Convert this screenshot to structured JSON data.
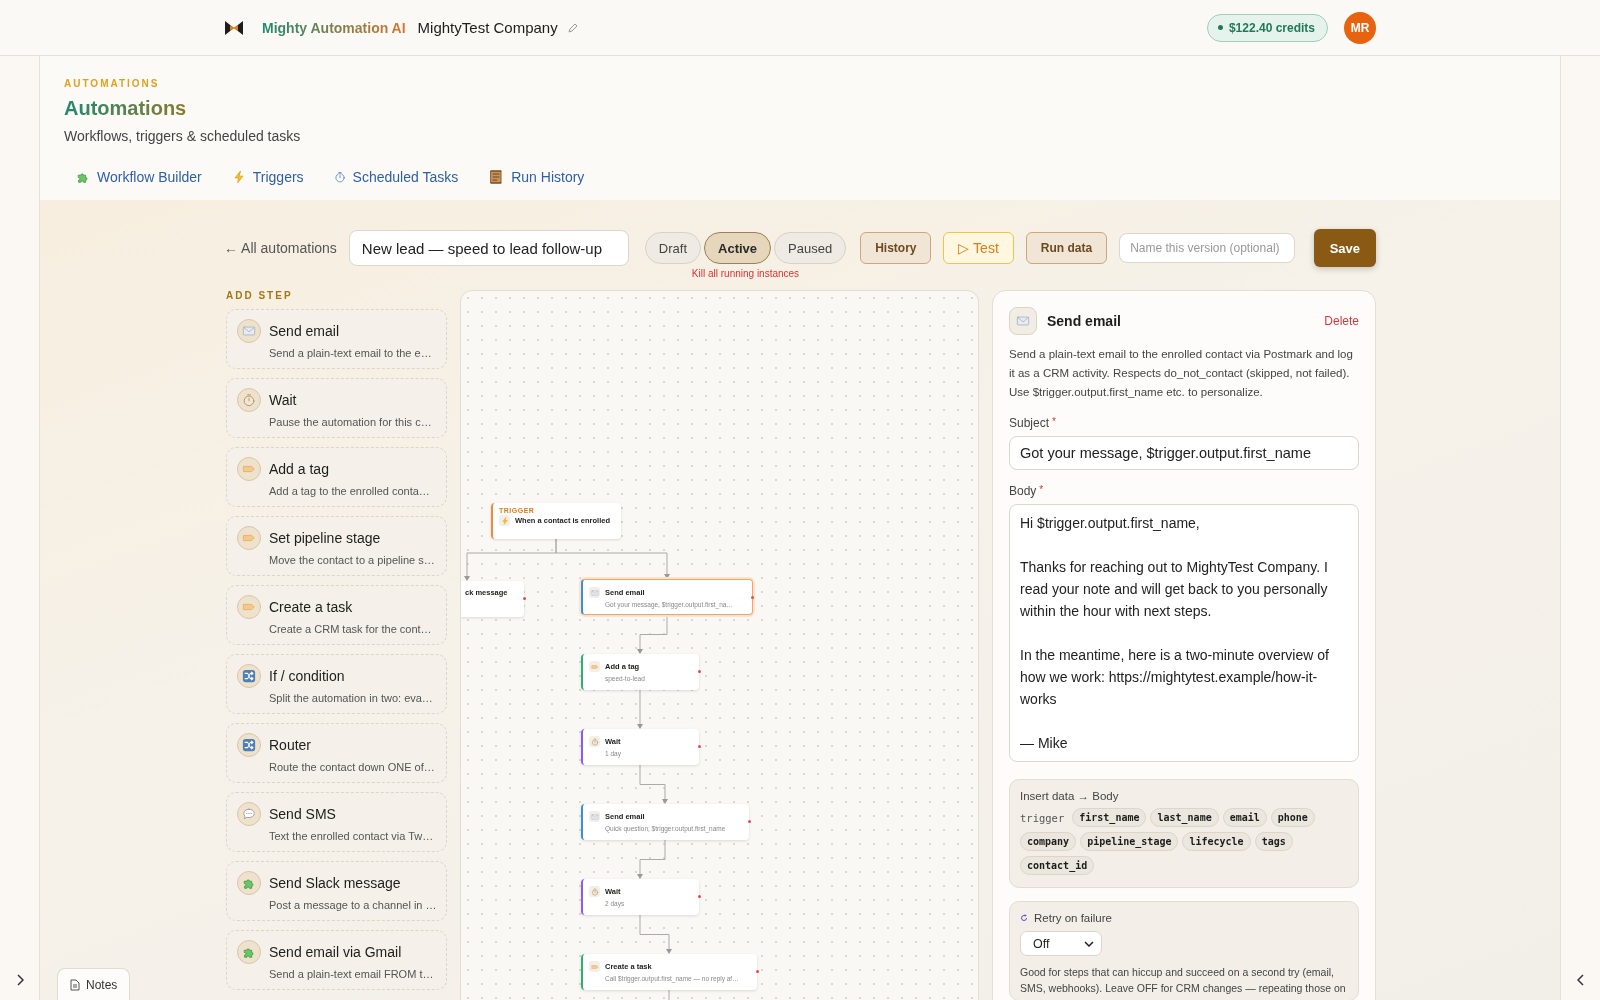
{
  "header": {
    "brand": "Mighty Automation AI",
    "workspace": "MightyTest Company",
    "credits": "$122.40 credits",
    "avatar": "MR"
  },
  "page": {
    "eyebrow": "AUTOMATIONS",
    "title": "Automations",
    "subtitle": "Workflows, triggers & scheduled tasks"
  },
  "tabs": [
    {
      "label": "Workflow Builder",
      "kind": "builder"
    },
    {
      "label": "Triggers",
      "kind": "triggers"
    },
    {
      "label": "Scheduled Tasks",
      "kind": "scheduled"
    },
    {
      "label": "Run History",
      "kind": "history"
    }
  ],
  "toolbar": {
    "back": "← All automations",
    "name": "New lead — speed to lead follow-up",
    "statuses": [
      {
        "label": "Draft",
        "selected": false
      },
      {
        "label": "Active",
        "selected": true
      },
      {
        "label": "Paused",
        "selected": false
      }
    ],
    "status_note": "Kill all running instances",
    "buttons": [
      {
        "label": "History",
        "kind": "plain"
      },
      {
        "label": "▷ Test",
        "kind": "test"
      },
      {
        "label": "Run data",
        "kind": "plain"
      }
    ],
    "version_placeholder": "Name this version (optional)",
    "save": "Save"
  },
  "add_step": {
    "heading": "ADD STEP",
    "items": [
      {
        "title": "Send email",
        "description": "Send a plain-text email to the e…",
        "kind": "email"
      },
      {
        "title": "Wait",
        "description": "Pause the automation for this c…",
        "kind": "wait"
      },
      {
        "title": "Add a tag",
        "description": "Add a tag to the enrolled conta…",
        "kind": "tag"
      },
      {
        "title": "Set pipeline stage",
        "description": "Move the contact to a pipeline s…",
        "kind": "pipeline"
      },
      {
        "title": "Create a task",
        "description": "Create a CRM task for the cont…",
        "kind": "task"
      },
      {
        "title": "If / condition",
        "description": "Split the automation in two: eva…",
        "kind": "condition"
      },
      {
        "title": "Router",
        "description": "Route the contact down ONE of…",
        "kind": "router"
      },
      {
        "title": "Send SMS",
        "description": "Text the enrolled contact via Tw…",
        "kind": "sms"
      },
      {
        "title": "Send Slack message",
        "description": "Post a message to a channel in …",
        "kind": "slack"
      },
      {
        "title": "Send email via Gmail",
        "description": "Send a plain-text email FROM t…",
        "kind": "gmail"
      }
    ]
  },
  "canvas": {
    "nodes": [
      {
        "kind": "trigger",
        "eyebrow": "TRIGGER",
        "title": "When a contact is enrolled",
        "selected": false
      },
      {
        "kind": "other",
        "title": "ck message",
        "selected": false
      },
      {
        "kind": "email",
        "title": "Send email",
        "subtitle": "Got your message, $trigger.output.first_na…",
        "selected": true
      },
      {
        "kind": "tag",
        "title": "Add a tag",
        "subtitle": "speed-to-lead",
        "selected": false
      },
      {
        "kind": "wait",
        "title": "Wait",
        "subtitle": "1 day",
        "selected": false
      },
      {
        "kind": "email",
        "title": "Send email",
        "subtitle": "Quick question, $trigger.output.first_name",
        "selected": false
      },
      {
        "kind": "wait",
        "title": "Wait",
        "subtitle": "2 days",
        "selected": false
      },
      {
        "kind": "task",
        "title": "Create a task",
        "subtitle": "Call $trigger.output.first_name — no reply af…",
        "selected": false
      }
    ]
  },
  "panel": {
    "kind": "email",
    "title": "Send email",
    "delete": "Delete",
    "description": "Send a plain-text email to the enrolled contact via Postmark and log it as a CRM activity. Respects do_not_contact (skipped, not failed). Use $trigger.output.first_name etc. to personalize.",
    "subject": {
      "label": "Subject",
      "mark": "*",
      "value": "Got your message, $trigger.output.first_name"
    },
    "body": {
      "label": "Body",
      "mark": "*",
      "value": "Hi $trigger.output.first_name,\n\nThanks for reaching out to MightyTest Company. I read your note and will get back to you personally within the hour with next steps.\n\nIn the meantime, here is a two-minute overview of how we work: https://mightytest.example/how-it-works\n\n— Mike"
    },
    "insert": {
      "title": "Insert data → Body",
      "source": "trigger",
      "fields": [
        "first_name",
        "last_name",
        "email",
        "phone",
        "company",
        "pipeline_stage",
        "lifecycle",
        "tags",
        "contact_id"
      ]
    },
    "retry": {
      "label": "Retry on failure",
      "value": "Off",
      "help": "Good for steps that can hiccup and succeed on a second try (email, SMS, webhooks). Leave OFF for CRM changes — repeating those on"
    }
  },
  "notes": "Notes"
}
